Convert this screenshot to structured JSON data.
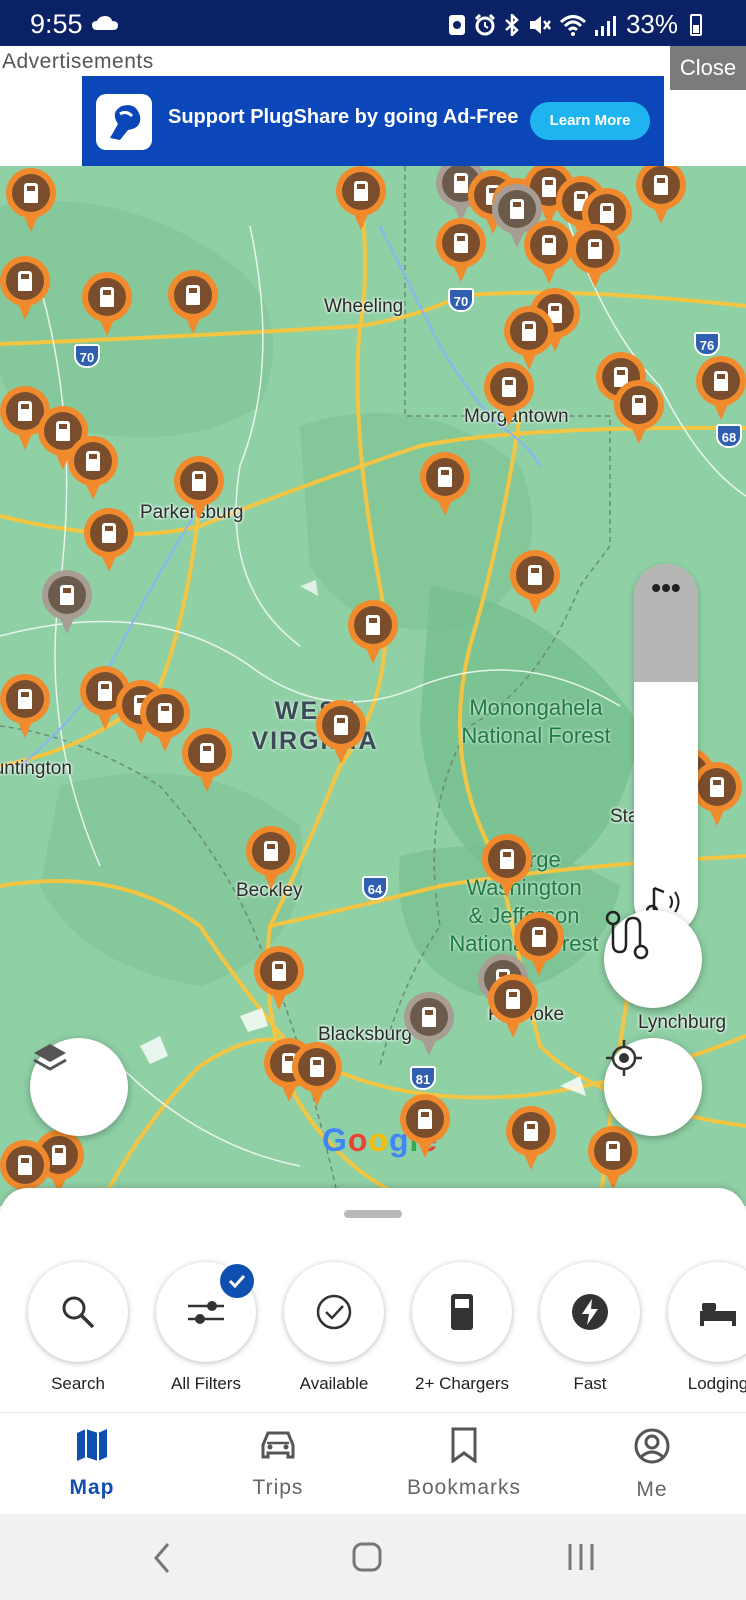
{
  "status_bar": {
    "time": "9:55",
    "battery": "33%",
    "icons": [
      "cloud-icon",
      "notification-icon",
      "alarm-icon",
      "bluetooth-icon",
      "mute-icon",
      "wifi-icon",
      "signal-icon",
      "battery-icon"
    ]
  },
  "ad": {
    "label": "Advertisements",
    "close": "Close",
    "banner_text": "Support PlugShare by going Ad-Free",
    "button": "Learn More"
  },
  "map": {
    "cities": [
      "Wheeling",
      "Morgantown",
      "Parkersburg",
      "Staunton",
      "Beckley",
      "Lynchburg",
      "Blacksburg",
      "Roanoke",
      "Huntington"
    ],
    "region_lines": [
      "WEST",
      "VIRGINIA"
    ],
    "forests": [
      {
        "lines": [
          "Monongahela",
          "National Forest"
        ]
      },
      {
        "lines": [
          "George",
          "Washington",
          "& Jefferson",
          "National Forest"
        ]
      }
    ],
    "highways": [
      "70",
      "70",
      "76",
      "68",
      "64",
      "64",
      "81"
    ],
    "attribution": "Google",
    "pin_color": "#f08a2c",
    "pin_core_color": "#7a4e2c",
    "volume_level": 0.32
  },
  "sheet": {
    "filters": [
      {
        "label": "Search",
        "icon": "search-icon"
      },
      {
        "label": "All Filters",
        "icon": "sliders-icon",
        "checked": true
      },
      {
        "label": "Available",
        "icon": "check-circle-icon"
      },
      {
        "label": "2+ Chargers",
        "icon": "charger-icon"
      },
      {
        "label": "Fast",
        "icon": "bolt-icon"
      },
      {
        "label": "Lodging",
        "icon": "bed-icon"
      }
    ]
  },
  "nav": {
    "items": [
      {
        "label": "Map",
        "icon": "map-icon",
        "active": true
      },
      {
        "label": "Trips",
        "icon": "car-icon"
      },
      {
        "label": "Bookmarks",
        "icon": "bookmark-icon"
      },
      {
        "label": "Me",
        "icon": "profile-icon"
      }
    ]
  },
  "accent": "#0f4fb0"
}
